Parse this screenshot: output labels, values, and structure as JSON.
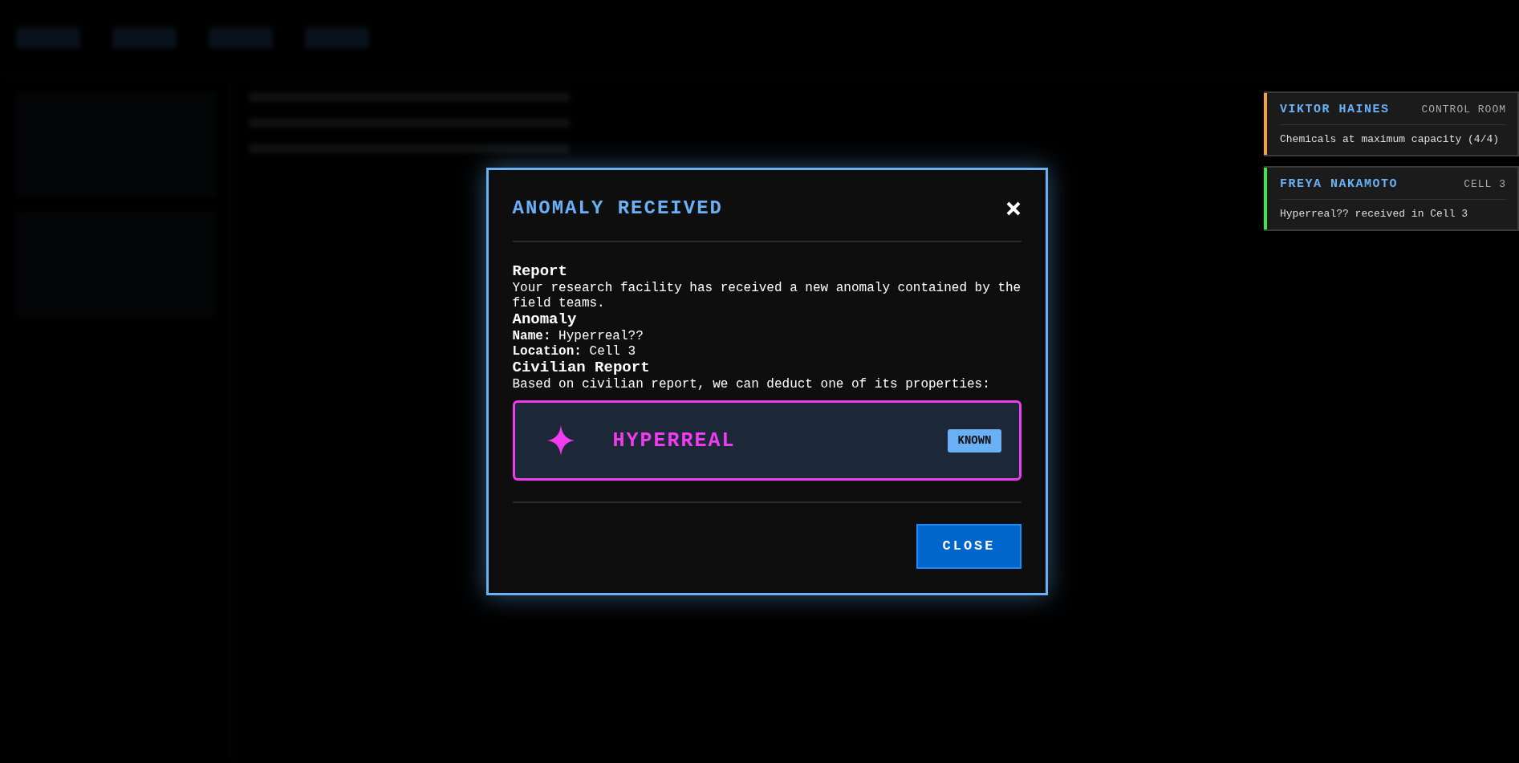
{
  "modal": {
    "title": "ANOMALY RECEIVED",
    "sections": [
      {
        "heading": "Report",
        "lines": [
          "Your research facility has received a new anomaly contained by the field teams."
        ]
      },
      {
        "heading": "Anomaly",
        "lines": [
          "**Name:** Hyperreal??",
          "**Location:** Cell 3"
        ]
      },
      {
        "heading": "Civilian Report",
        "lines": [
          "Based on civilian report, we can deduct one of its properties:"
        ]
      }
    ],
    "property": {
      "name": "HYPERREAL",
      "status": "KNOWN"
    },
    "button": "CLOSE"
  },
  "notifications": [
    {
      "title": "VIKTOR HAINES",
      "location": "CONTROL ROOM",
      "message": "Chemicals at maximum capacity (4/4)",
      "color": "#f5a142"
    },
    {
      "title": "FREYA NAKAMOTO",
      "location": "CELL 3",
      "message": "Hyperreal?? received in Cell 3",
      "color": "#3ee83e"
    }
  ]
}
